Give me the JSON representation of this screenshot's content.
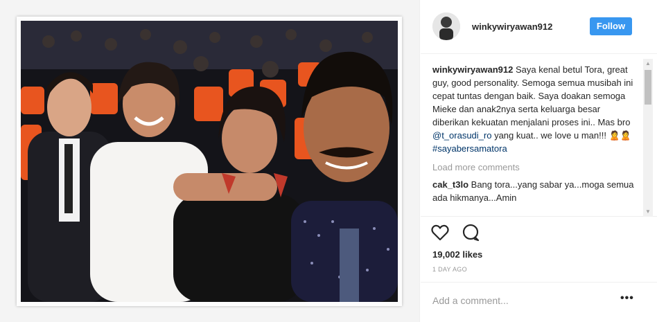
{
  "post": {
    "username": "winkywiryawan912",
    "follow_label": "Follow",
    "caption_user": "winkywiryawan912",
    "caption_text_1": " Saya kenal betul Tora, great guy, good personality. Semoga semua musibah ini cepat tuntas dengan baik. Saya doakan semoga Mieke dan anak2nya serta keluarga besar diberikan kekuatan menjalani proses ini.. Mas bro ",
    "mention": "@t_orasudi_ro",
    "caption_text_2": " yang kuat.. we love u man!!! ",
    "emoji": "🙎🙎",
    "hashtag": "#sayabersamatora",
    "load_more": "Load more comments",
    "comments": [
      {
        "user": "cak_t3lo",
        "text": " Bang tora...yang sabar ya...moga semua ada hikmanya...Amin"
      },
      {
        "user": "",
        "text": ""
      }
    ],
    "likes": "19,002 likes",
    "time": "1 DAY AGO",
    "comment_placeholder": "Add a comment...",
    "more_options": "•••"
  },
  "icons": {
    "like": "heart-outline-icon",
    "comment": "speech-bubble-icon",
    "more": "more-options-icon",
    "scroll_up": "▲",
    "scroll_down": "▼"
  },
  "colors": {
    "follow": "#3897f0",
    "link": "#003569",
    "muted": "#999999",
    "seats": "#e8551f"
  }
}
